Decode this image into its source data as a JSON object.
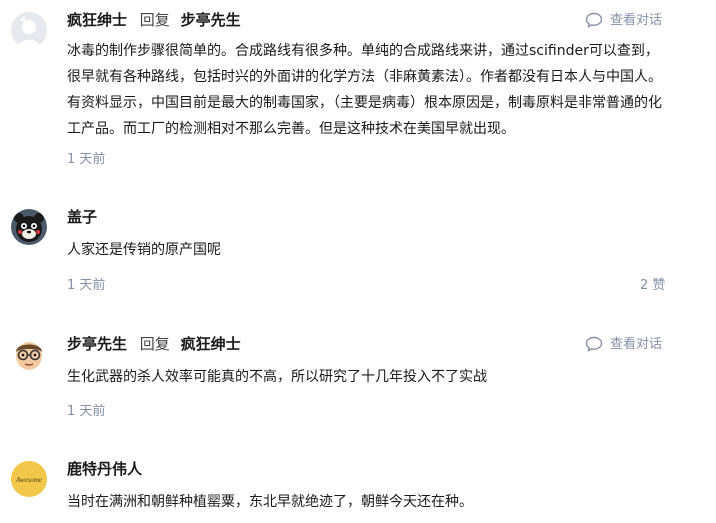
{
  "comments": [
    {
      "author": "疯狂绅士",
      "reply_word": "回复",
      "reply_to": "步亭先生",
      "view_conversation": "查看对话",
      "content": "冰毒的制作步骤很简单的。合成路线有很多种。单纯的合成路线来讲，通过scifinder可以查到，很早就有各种路线，包括时兴的外面讲的化学方法（非麻黄素法）。作者都没有日本人与中国人。有资料显示，中国目前是最大的制毒国家，（主要是病毒）根本原因是，制毒原料是非常普通的化工产品。而工厂的检测相对不那么完善。但是这种技术在美国早就出现。",
      "time": "1 天前"
    },
    {
      "author": "盖子",
      "content": "人家还是传销的原产国呢",
      "time": "1 天前",
      "likes": "2 赞"
    },
    {
      "author": "步亭先生",
      "reply_word": "回复",
      "reply_to": "疯狂绅士",
      "view_conversation": "查看对话",
      "content": "生化武器的杀人效率可能真的不高，所以研究了十几年投入不了实战",
      "time": "1 天前"
    },
    {
      "author": "鹿特丹伟人",
      "avatar_text": "Awesome",
      "content": "当时在满洲和朝鲜种植罂粟，东北早就绝迹了，朝鲜今天还在种。"
    }
  ],
  "colors": {
    "text": "#1a1a1a",
    "meta": "#8590a6",
    "avatar4_bg": "#f2c84b"
  },
  "icons": {
    "conversation": "speech-bubble-icon"
  }
}
